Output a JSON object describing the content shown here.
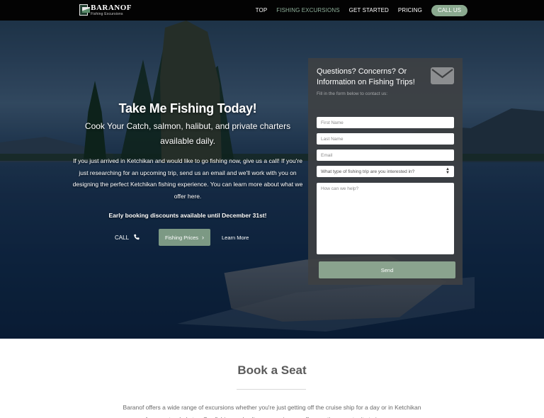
{
  "brand": {
    "title": "BARANOF",
    "subtitle": "Fishing Excursions"
  },
  "nav": {
    "items": [
      {
        "label": "TOP"
      },
      {
        "label": "FISHING EXCURSIONS"
      },
      {
        "label": "GET STARTED"
      },
      {
        "label": "PRICING"
      }
    ],
    "active_index": 1,
    "call_label": "CALL US"
  },
  "hero": {
    "title": "Take Me Fishing Today!",
    "subtitle": "Cook Your Catch, salmon, halibut, and private charters available daily.",
    "body": "If you just arrived in Ketchikan and would like to go fishing now, give us a call! If you're just researching for an upcoming trip, send us an email and we'll work with you on designing the perfect Ketchikan fishing experience. You can learn more about what we offer here.",
    "discount": "Early booking discounts available until December 31st!",
    "cta_call": "CALL",
    "cta_prices": "Fishing Prices",
    "cta_more": "Learn More"
  },
  "form": {
    "title": "Questions? Concerns? Or Information on Fishing Trips!",
    "subtitle": "Fill in the form below to contact us:",
    "first_name_placeholder": "First Name",
    "last_name_placeholder": "Last Name",
    "email_placeholder": "Email",
    "trip_select_value": "What type of fishing trip are you interested in?",
    "message_placeholder": "How can we help?",
    "send_label": "Send"
  },
  "book": {
    "title": "Book a Seat",
    "text": "Baranof offers a wide range of excursions whether you're just getting off the cruise ship for a day or in Ketchikan for an extended stay. Our fishing and culinary experiences offer you the opportunity to immerse"
  },
  "icons": {
    "phone": "phone-icon",
    "chevron": "chevron-right-icon",
    "mail": "envelope-icon",
    "select": "select-arrows-icon"
  },
  "colors": {
    "nav_bg": "#030303",
    "accent": "#8aa98f",
    "active_nav": "#8fb19b",
    "panel_bg": "#3e4042"
  }
}
